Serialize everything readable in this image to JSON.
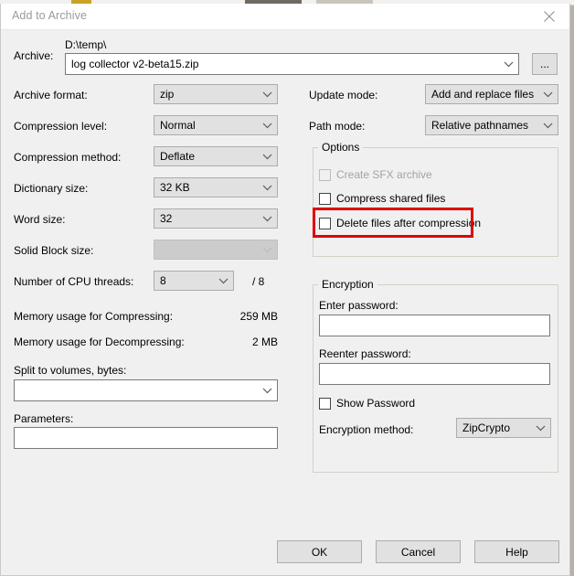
{
  "window": {
    "title": "Add to Archive",
    "close_icon": "close-icon"
  },
  "archive": {
    "label": "Archive:",
    "path": "D:\\temp\\",
    "filename": "log collector v2-beta15.zip",
    "browse_label": "..."
  },
  "left_column": {
    "archive_format": {
      "label": "Archive format:",
      "value": "zip"
    },
    "compression_level": {
      "label": "Compression level:",
      "value": "Normal"
    },
    "compression_method": {
      "label": "Compression method:",
      "value": "Deflate"
    },
    "dictionary_size": {
      "label": "Dictionary size:",
      "value": "32 KB"
    },
    "word_size": {
      "label": "Word size:",
      "value": "32"
    },
    "solid_block_size": {
      "label": "Solid Block size:",
      "value": ""
    },
    "cpu_threads": {
      "label": "Number of CPU threads:",
      "value": "8",
      "total": "/ 8"
    },
    "memory_compress": {
      "label": "Memory usage for Compressing:",
      "value": "259 MB"
    },
    "memory_decompress": {
      "label": "Memory usage for Decompressing:",
      "value": "2 MB"
    },
    "split_volumes": {
      "label": "Split to volumes, bytes:",
      "value": ""
    },
    "parameters": {
      "label": "Parameters:",
      "value": ""
    }
  },
  "right_column": {
    "update_mode": {
      "label": "Update mode:",
      "value": "Add and replace files"
    },
    "path_mode": {
      "label": "Path mode:",
      "value": "Relative pathnames"
    },
    "options": {
      "title": "Options",
      "items": [
        {
          "label": "Create SFX archive",
          "checked": false,
          "disabled": true,
          "highlighted": false
        },
        {
          "label": "Compress shared files",
          "checked": false,
          "disabled": false,
          "highlighted": false
        },
        {
          "label": "Delete files after compression",
          "checked": false,
          "disabled": false,
          "highlighted": true
        }
      ]
    },
    "encryption": {
      "title": "Encryption",
      "enter_password_label": "Enter password:",
      "enter_password_value": "",
      "reenter_password_label": "Reenter password:",
      "reenter_password_value": "",
      "show_password_label": "Show Password",
      "show_password_checked": false,
      "method_label": "Encryption method:",
      "method_value": "ZipCrypto"
    }
  },
  "footer": {
    "ok": "OK",
    "cancel": "Cancel",
    "help": "Help"
  },
  "colors": {
    "highlight": "#e00000",
    "dialog_bg": "#f0f0f0",
    "control_bg": "#e1e1e1"
  }
}
